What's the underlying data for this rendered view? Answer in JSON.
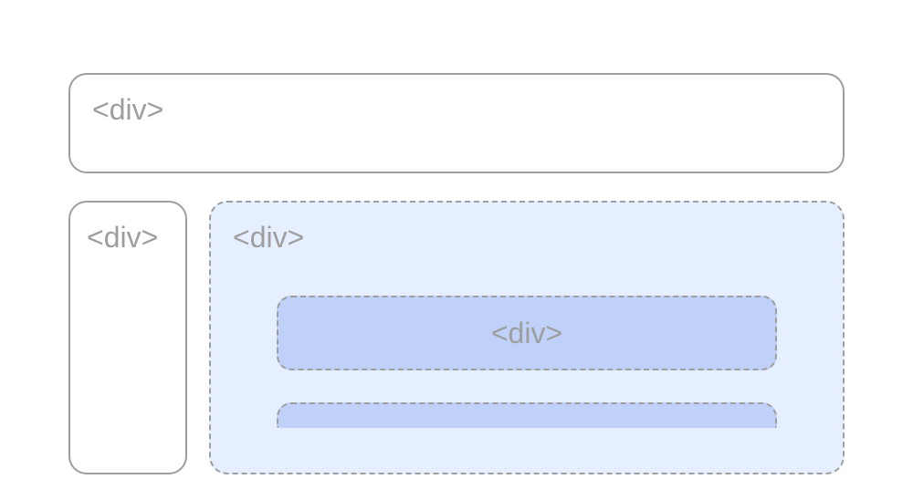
{
  "diagram": {
    "header": {
      "label": "<div>"
    },
    "sidebar": {
      "label": "<div>"
    },
    "main": {
      "label": "<div>",
      "children": [
        {
          "label": "<div>"
        },
        {
          "label": ""
        }
      ]
    }
  }
}
